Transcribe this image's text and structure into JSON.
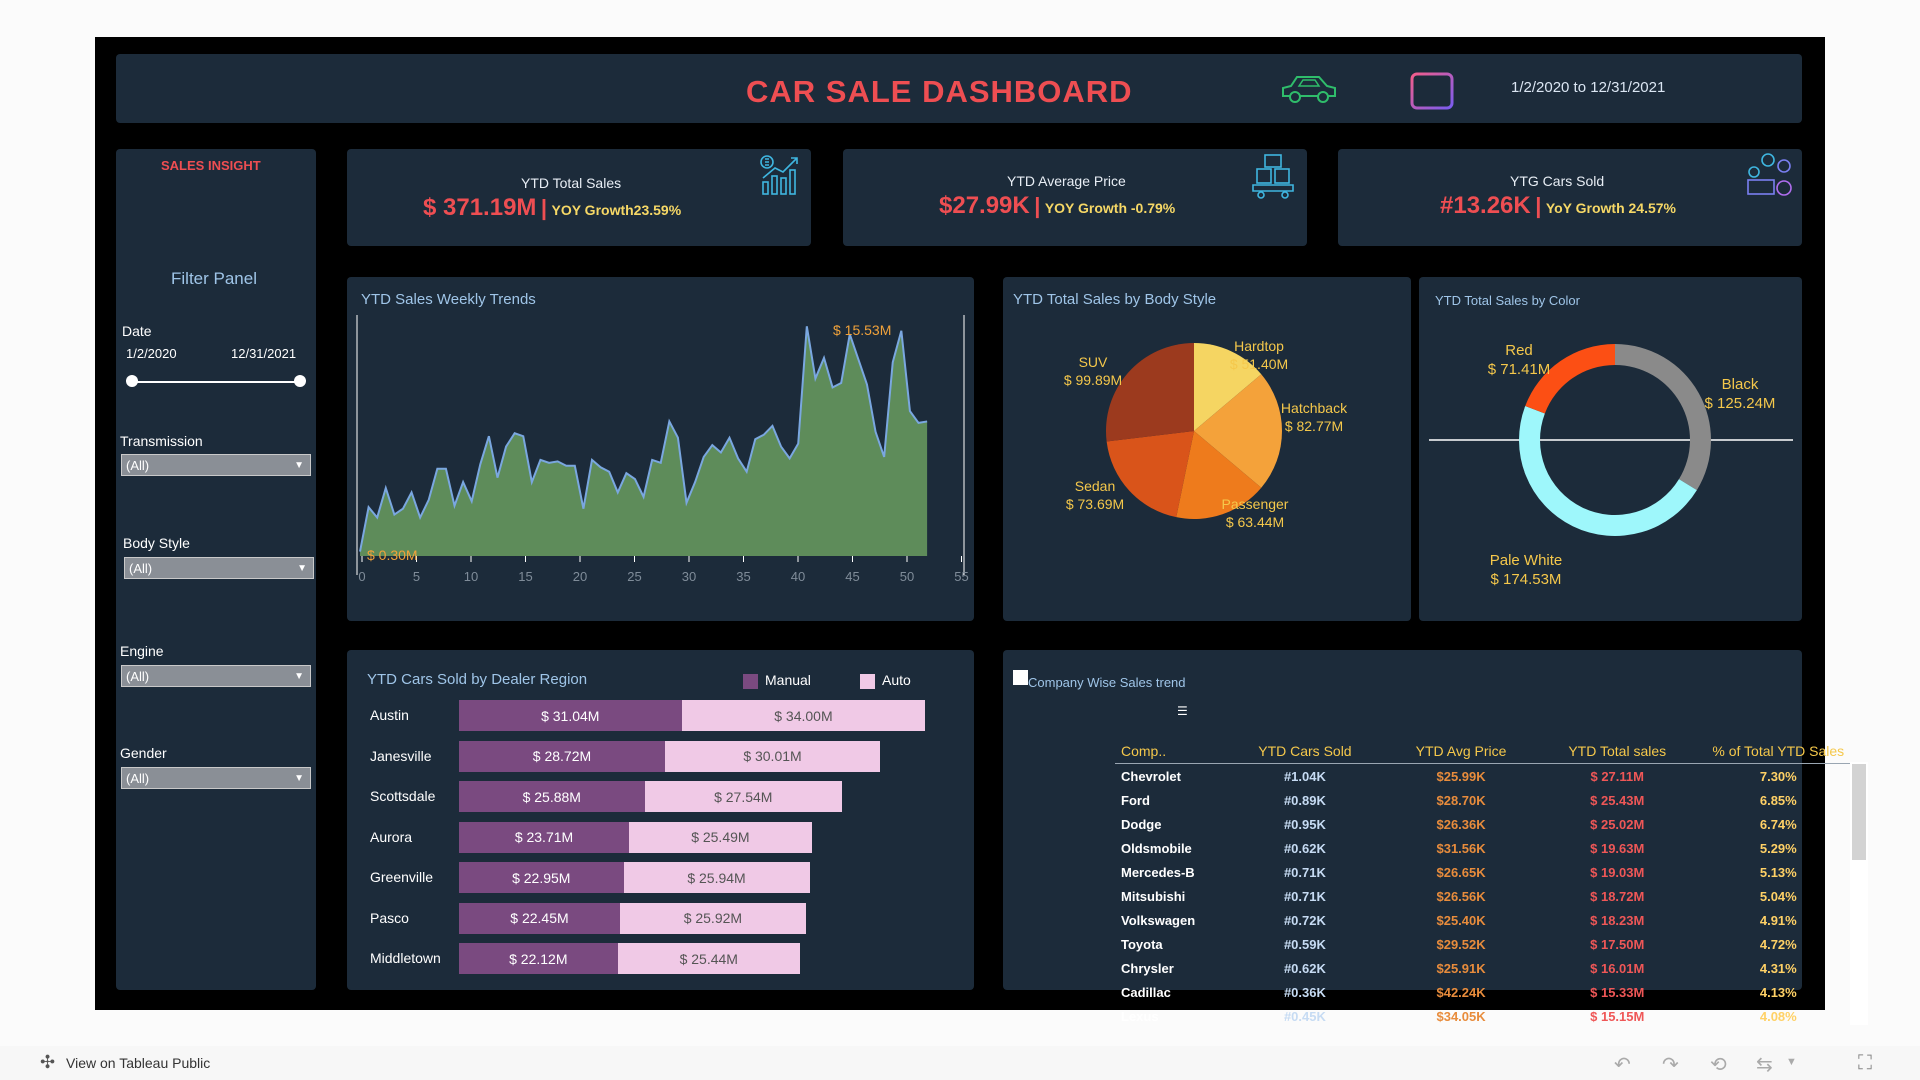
{
  "header": {
    "title": "CAR SALE DASHBOARD",
    "date_range": "1/2/2020 to 12/31/2021",
    "car_icon": "car-icon",
    "calendar_icon": "calendar-icon"
  },
  "sidebar": {
    "title": "SALES INSIGHT",
    "filter_panel": "Filter Panel",
    "date_label": "Date",
    "date_start": "1/2/2020",
    "date_end": "12/31/2021",
    "filters": [
      {
        "label": "Transmission",
        "value": "(All)"
      },
      {
        "label": "Body Style",
        "value": "(All)"
      },
      {
        "label": "Engine",
        "value": "(All)"
      },
      {
        "label": "Gender",
        "value": "(All)"
      }
    ]
  },
  "kpis": [
    {
      "title": "YTD Total Sales",
      "value": "$ 371.19M",
      "sep": "|",
      "growth": "YOY Growth23.59%",
      "icon": "bar-chart-dollar-icon"
    },
    {
      "title": "YTD Average Price",
      "value": "$27.99K",
      "sep": "|",
      "growth": "YOY Growth -0.79%",
      "icon": "boxes-cart-icon"
    },
    {
      "title": "YTG Cars Sold",
      "value": "#13.26K",
      "sep": "|",
      "growth": "YoY Growth 24.57%",
      "icon": "coins-cash-icon"
    }
  ],
  "weekly": {
    "title": "YTD Sales Weekly Trends",
    "max_label": "$ 15.53M",
    "min_label": "$ 0.30M"
  },
  "body_style": {
    "title": "YTD Total Sales by Body Style"
  },
  "color_chart": {
    "title": "YTD Total Sales by Color"
  },
  "region": {
    "title": "YTD Cars Sold by Dealer Region",
    "legend_manual": "Manual",
    "legend_auto": "Auto",
    "colors": {
      "manual": "#7a4a80",
      "auto": "#f0c9e6"
    }
  },
  "company": {
    "title": "Company Wise Sales trend",
    "columns": [
      "Comp..",
      "YTD Cars Sold",
      "YTD Avg Price",
      "YTD Total sales",
      "% of Total YTD Sales"
    ],
    "rows": [
      [
        "Chevrolet",
        "#1.04K",
        "$25.99K",
        "$ 27.11M",
        "7.30%"
      ],
      [
        "Ford",
        "#0.89K",
        "$28.70K",
        "$ 25.43M",
        "6.85%"
      ],
      [
        "Dodge",
        "#0.95K",
        "$26.36K",
        "$ 25.02M",
        "6.74%"
      ],
      [
        "Oldsmobile",
        "#0.62K",
        "$31.56K",
        "$ 19.63M",
        "5.29%"
      ],
      [
        "Mercedes-B",
        "#0.71K",
        "$26.65K",
        "$ 19.03M",
        "5.13%"
      ],
      [
        "Mitsubishi",
        "#0.71K",
        "$26.56K",
        "$ 18.72M",
        "5.04%"
      ],
      [
        "Volkswagen",
        "#0.72K",
        "$25.40K",
        "$ 18.23M",
        "4.91%"
      ],
      [
        "Toyota",
        "#0.59K",
        "$29.52K",
        "$ 17.50M",
        "4.72%"
      ],
      [
        "Chrysler",
        "#0.62K",
        "$25.91K",
        "$ 16.01M",
        "4.31%"
      ],
      [
        "Cadillac",
        "#0.36K",
        "$42.24K",
        "$ 15.33M",
        "4.13%"
      ],
      [
        "Lexus",
        "#0.45K",
        "$34.05K",
        "$ 15.15M",
        "4.08%"
      ]
    ]
  },
  "footer": {
    "view_label": "View on Tableau Public"
  },
  "chart_data": [
    {
      "type": "area",
      "title": "YTD Sales Weekly Trends",
      "xlim": [
        0,
        55
      ],
      "x_ticks": [
        "0",
        "5",
        "10",
        "15",
        "20",
        "25",
        "30",
        "35",
        "40",
        "45",
        "50",
        "55"
      ],
      "x": [
        1,
        2,
        3,
        4,
        5,
        6,
        7,
        8,
        9,
        10,
        11,
        12,
        13,
        14,
        15,
        16,
        17,
        18,
        19,
        20,
        21,
        22,
        23,
        24,
        25,
        26,
        27,
        28,
        29,
        30,
        31,
        32,
        33,
        34,
        35,
        36,
        37,
        38,
        39,
        40,
        41,
        42,
        43,
        44,
        45,
        46,
        47,
        48,
        49,
        50,
        51,
        52,
        53
      ],
      "values": [
        0.3,
        3.3,
        2.6,
        4.6,
        2.8,
        3.2,
        4.3,
        2.6,
        3.8,
        5.9,
        5.9,
        3.4,
        5.0,
        3.7,
        6.2,
        8.1,
        5.3,
        7.4,
        8.3,
        8.1,
        5.0,
        6.5,
        6.3,
        6.4,
        6.1,
        6.1,
        3.2,
        6.5,
        6.0,
        5.7,
        4.3,
        5.6,
        5.2,
        4.0,
        6.5,
        6.3,
        9.1,
        8.0,
        3.6,
        5.0,
        6.7,
        7.5,
        7.0,
        8.0,
        6.6,
        5.7,
        7.9,
        8.2,
        8.8,
        7.4,
        6.6,
        7.6,
        15.53,
        12.0,
        13.4,
        11.4,
        11.7,
        15.0,
        13.3,
        11.6,
        8.4,
        6.7,
        13.1,
        15.23,
        9.8,
        9.0,
        9.1
      ]
    },
    {
      "type": "pie",
      "title": "YTD Total Sales by Body Style",
      "categories": [
        "Hardtop",
        "Hatchback",
        "Passenger",
        "Sedan",
        "SUV"
      ],
      "values": [
        51.4,
        82.77,
        63.44,
        73.69,
        99.89
      ],
      "labels": [
        "$ 51.40M",
        "$ 82.77M",
        "$ 63.44M",
        "$ 73.69M",
        "$ 99.89M"
      ],
      "colors": [
        "#f5d562",
        "#f4a23a",
        "#ee7b1c",
        "#d9541a",
        "#9c3a1e"
      ]
    },
    {
      "type": "pie",
      "title": "YTD Total Sales by Color",
      "categories": [
        "Black",
        "Pale White",
        "Red"
      ],
      "values": [
        125.24,
        174.53,
        71.41
      ],
      "labels": [
        "$ 125.24M",
        "$ 174.53M",
        "$ 71.41M"
      ],
      "colors": [
        "#8a8a8a",
        "#9ef7fb",
        "#fc4f14"
      ]
    },
    {
      "type": "bar",
      "title": "YTD Cars Sold by Dealer Region",
      "categories": [
        "Austin",
        "Janesville",
        "Scottsdale",
        "Aurora",
        "Greenville",
        "Pasco",
        "Middletown"
      ],
      "series": [
        {
          "name": "Manual",
          "values": [
            31.04,
            28.72,
            25.88,
            23.71,
            22.95,
            22.45,
            22.12
          ],
          "labels": [
            "$ 31.04M",
            "$ 28.72M",
            "$ 25.88M",
            "$ 23.71M",
            "$ 22.95M",
            "$ 22.45M",
            "$ 22.12M"
          ]
        },
        {
          "name": "Auto",
          "values": [
            34.0,
            30.01,
            27.54,
            25.49,
            25.94,
            25.92,
            25.44
          ],
          "labels": [
            "$ 34.00M",
            "$ 30.01M",
            "$ 27.54M",
            "$ 25.49M",
            "$ 25.94M",
            "$ 25.92M",
            "$ 25.44M"
          ]
        }
      ]
    }
  ]
}
